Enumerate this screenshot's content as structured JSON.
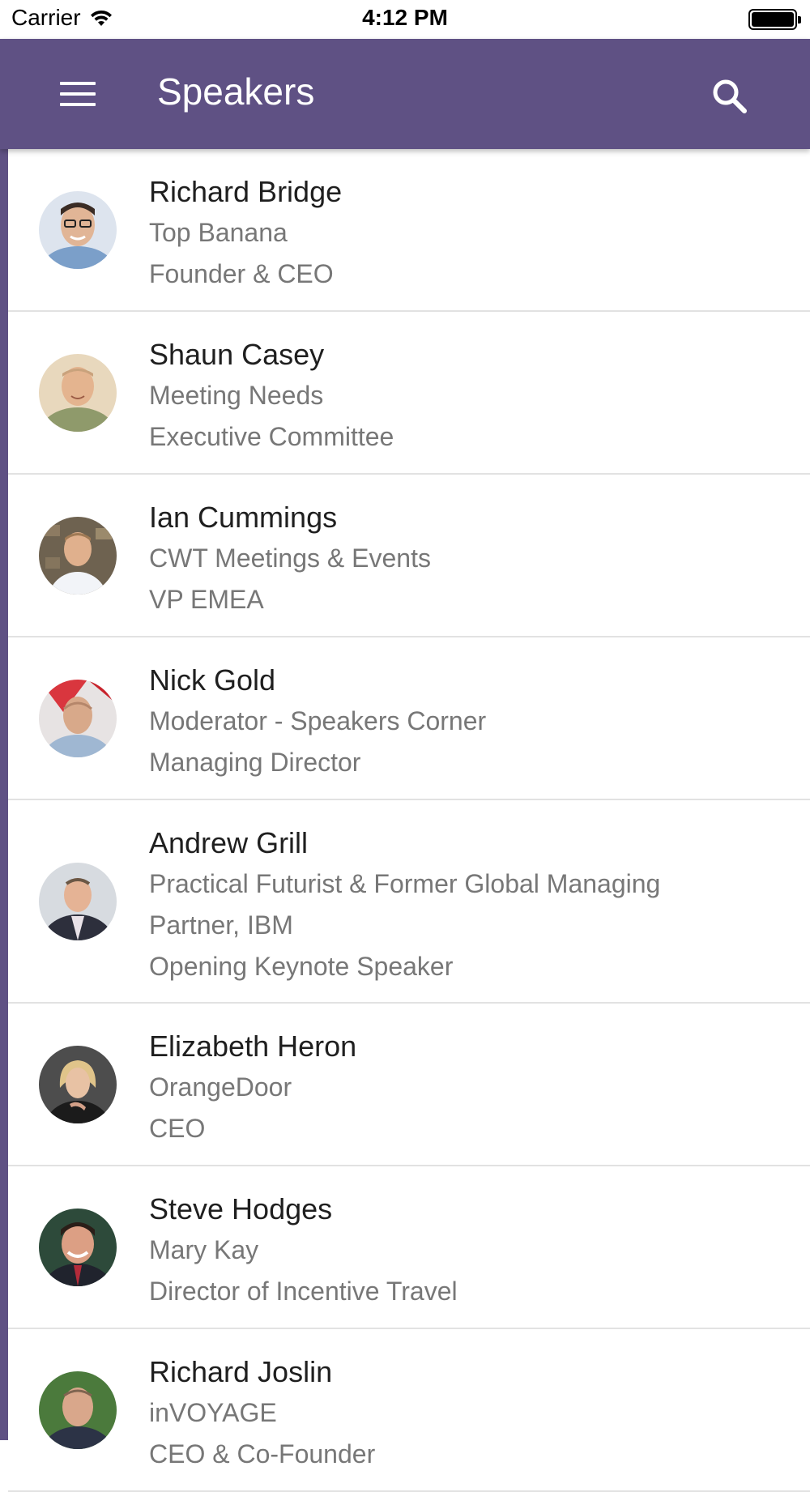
{
  "status_bar": {
    "carrier": "Carrier",
    "time": "4:12 PM"
  },
  "app_bar": {
    "title": "Speakers",
    "background": "#5f5184"
  },
  "speakers": [
    {
      "name": "Richard Bridge",
      "company": "Top Banana",
      "role": "Founder & CEO"
    },
    {
      "name": "Shaun Casey",
      "company": "Meeting Needs",
      "role": "Executive Committee"
    },
    {
      "name": "Ian Cummings",
      "company": "CWT Meetings & Events",
      "role": "VP EMEA"
    },
    {
      "name": "Nick Gold",
      "company": "Moderator - Speakers Corner",
      "role": "Managing Director"
    },
    {
      "name": "Andrew Grill",
      "company_line1": "Practical Futurist & Former Global Managing",
      "company_line2": "Partner, IBM",
      "role": "Opening Keynote Speaker"
    },
    {
      "name": "Elizabeth Heron",
      "company": "OrangeDoor",
      "role": "CEO"
    },
    {
      "name": "Steve Hodges",
      "company": "Mary Kay",
      "role": "Director of Incentive Travel"
    },
    {
      "name": "Richard Joslin",
      "company": "inVOYAGE",
      "role": "CEO & Co-Founder"
    }
  ]
}
